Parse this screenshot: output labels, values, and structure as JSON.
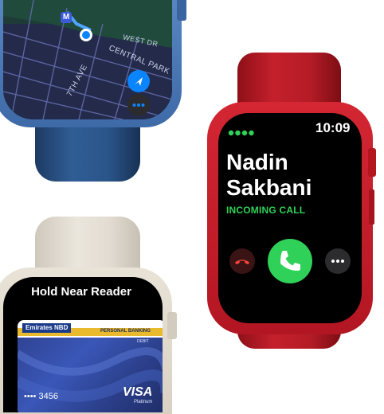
{
  "map": {
    "streets": [
      "WEST DR",
      "CENTRAL PARK",
      "7TH AVE"
    ],
    "marker_letter": "M"
  },
  "call": {
    "time": "10:09",
    "caller_first": "Nadin",
    "caller_last": "Sakbani",
    "status": "INCOMING CALL",
    "colors": {
      "accent_green": "#30d158",
      "decline_red": "#ff453a",
      "case_red": "#c41e2a"
    }
  },
  "pay": {
    "header": "Hold Near Reader",
    "bank_name": "Emirates NBD",
    "card_tier_label": "PERSONAL BANKING",
    "card_type_label": "DEBIT",
    "card_last4": "•••• 3456",
    "network": "VISA",
    "network_tier": "Platinum"
  }
}
